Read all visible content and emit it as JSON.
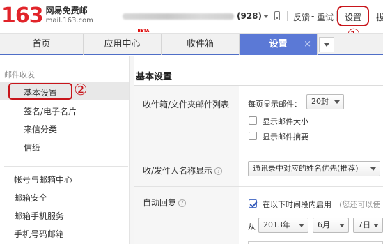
{
  "header": {
    "logo_number": "163",
    "logo_name": "网易免费邮",
    "logo_domain": "mail.163.com",
    "mail_count": "(928)",
    "feedback_link": "反馈",
    "separator": "-",
    "retry_link": "重试",
    "settings_link": "设置",
    "exit_link": "拔",
    "annotation_1": "①"
  },
  "tabs": [
    {
      "label": "首页"
    },
    {
      "label": "应用中心",
      "badge": "BETA"
    },
    {
      "label": "收件箱"
    },
    {
      "label": "设置",
      "active": true,
      "close": "×"
    }
  ],
  "sidebar": {
    "group_mail": "邮件收发",
    "items_mail": [
      "基本设置",
      "签名/电子名片",
      "来信分类",
      "信纸"
    ],
    "annotation_2": "②",
    "items_account": [
      "帐号与邮箱中心",
      "邮箱安全",
      "邮箱手机服务",
      "手机号码邮箱"
    ]
  },
  "main": {
    "title": "基本设置",
    "row1": {
      "label": "收件箱/文件夹邮件列表",
      "per_page_label": "每页显示邮件：",
      "per_page_value": "20封",
      "opt_size": "显示邮件大小",
      "opt_summary": "显示邮件摘要"
    },
    "row2": {
      "label": "收/发件人名称显示",
      "help": "?",
      "value": "通讯录中对应的姓名优先(推荐)"
    },
    "row3": {
      "label": "自动回复",
      "help": "?",
      "enable_label": "在以下时间段内启用",
      "hint": "(您还可以使",
      "from_label": "从",
      "year": "2013年",
      "month": "6月",
      "day": "7日"
    }
  },
  "colors": {
    "brand_red": "#e1242a",
    "tab_active": "#5b79d6",
    "annotation": "#c8151b"
  }
}
